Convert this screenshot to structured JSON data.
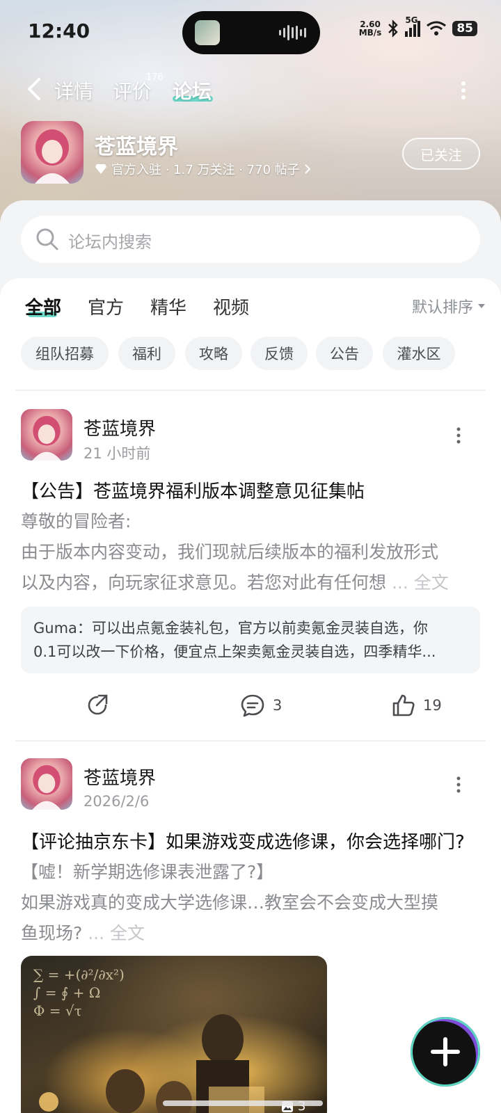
{
  "status_bar": {
    "time": "12:40",
    "net_speed_value": "2.60",
    "net_speed_unit": "MB/s",
    "network": "5G",
    "battery": "85"
  },
  "nav": {
    "tabs": [
      {
        "label": "详情"
      },
      {
        "label": "评价",
        "badge": "176"
      },
      {
        "label": "论坛",
        "active": true
      }
    ]
  },
  "game": {
    "name": "苍蓝境界",
    "meta": "官方入驻 · 1.7 万关注 · 770 帖子",
    "follow_label": "已关注"
  },
  "search": {
    "placeholder": "论坛内搜索"
  },
  "category_tabs": [
    {
      "label": "全部",
      "active": true
    },
    {
      "label": "官方"
    },
    {
      "label": "精华"
    },
    {
      "label": "视频"
    }
  ],
  "sort_label": "默认排序",
  "chips": [
    "组队招募",
    "福利",
    "攻略",
    "反馈",
    "公告",
    "灌水区"
  ],
  "posts": [
    {
      "author": "苍蓝境界",
      "time": "21 小时前",
      "title": "【公告】苍蓝境界福利版本调整意见征集帖",
      "body_line1": "尊敬的冒险者:",
      "body_line2": "由于版本内容变动，我们现就后续版本的福利发放形式",
      "body_line3": "以及内容，向玩家征求意见。若您对此有任何想",
      "fulltext": "... 全文",
      "comment_line1": "Guma：可以出点氪金装礼包，官方以前卖氪金灵装自选，你",
      "comment_line2": "0.1可以改一下价格，便宜点上架卖氪金灵装自选，四季精华...",
      "comments": "3",
      "likes": "19"
    },
    {
      "author": "苍蓝境界",
      "time": "2026/2/6",
      "title": "【评论抽京东卡】如果游戏变成选修课，你会选择哪门?",
      "body_line1": "【嘘！新学期选修课表泄露了?】",
      "body_line2": "如果游戏真的变成大学选修课…教室会不会变成大型摸",
      "body_line3": "鱼现场?",
      "fulltext": "... 全文",
      "image_count": "3"
    }
  ],
  "colors": {
    "accent": "#5ed6c4",
    "fab_ring": "#7d4dd8"
  }
}
